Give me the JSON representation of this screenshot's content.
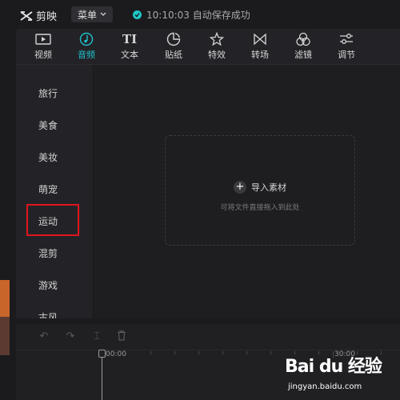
{
  "app": {
    "name": "剪映"
  },
  "menu": {
    "label": "菜单"
  },
  "status": {
    "text": "10:10:03 自动保存成功"
  },
  "tabs": [
    {
      "label": "视频",
      "icon": "video-icon"
    },
    {
      "label": "音频",
      "icon": "audio-icon",
      "active": true
    },
    {
      "label": "文本",
      "icon": "text-icon"
    },
    {
      "label": "贴纸",
      "icon": "sticker-icon"
    },
    {
      "label": "特效",
      "icon": "effects-icon"
    },
    {
      "label": "转场",
      "icon": "transition-icon"
    },
    {
      "label": "滤镜",
      "icon": "filter-icon"
    },
    {
      "label": "调节",
      "icon": "adjust-icon"
    }
  ],
  "categories": [
    "旅行",
    "美食",
    "美妆",
    "萌宠",
    "运动",
    "混剪",
    "游戏",
    "古风"
  ],
  "highlighted_category": "运动",
  "import": {
    "label": "导入素材",
    "hint": "可将文件直接拖入到此处"
  },
  "timeline": {
    "start_time": "00:00",
    "mark_time": "30:00"
  },
  "watermark": {
    "main": "Bai du 经验",
    "sub": "jingyan.baidu.com"
  },
  "colors": {
    "accent": "#20c2ce",
    "highlight_border": "#e0161b",
    "background": "#1b1b1e"
  }
}
